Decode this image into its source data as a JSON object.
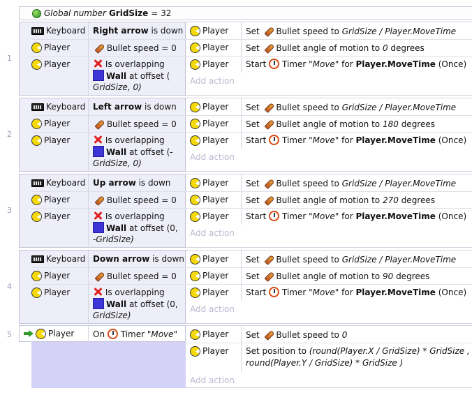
{
  "global": {
    "label": "Global number",
    "name": "GridSize",
    "value": "= 32"
  },
  "events": [
    {
      "number": "1",
      "conditions": [
        {
          "object": "Keyboard",
          "icon": "keyboard-icon",
          "bold": "Right arrow",
          "text": " is down"
        },
        {
          "object": "Player",
          "icon": "pacman-icon",
          "text": "Bullet speed = 0"
        },
        {
          "object": "Player",
          "icon": "pacman-icon",
          "line1": "Is overlapping",
          "wall": "Wall",
          "line2": " at offset (",
          "line3": "GridSize, 0)"
        }
      ],
      "actions": [
        {
          "object": "Player",
          "verb": "Set",
          "text": "Bullet speed to ",
          "expr": "GridSize / Player.MoveTime"
        },
        {
          "object": "Player",
          "verb": "Set",
          "text": "Bullet angle of motion to ",
          "expr": "0",
          "tail": " degrees"
        },
        {
          "object": "Player",
          "verb": "Start",
          "text": "Timer ",
          "expr": "\"Move\"",
          "for": " for ",
          "bold": "Player.MoveTime",
          "tail": " (Once)"
        }
      ]
    },
    {
      "number": "2",
      "conditions": [
        {
          "object": "Keyboard",
          "icon": "keyboard-icon",
          "bold": "Left arrow",
          "text": " is down"
        },
        {
          "object": "Player",
          "icon": "pacman-icon",
          "text": "Bullet speed = 0"
        },
        {
          "object": "Player",
          "icon": "pacman-icon",
          "line1": "Is overlapping",
          "wall": "Wall",
          "line2": " at offset (-",
          "line3": "GridSize, 0)"
        }
      ],
      "actions": [
        {
          "object": "Player",
          "verb": "Set",
          "text": "Bullet speed to ",
          "expr": "GridSize / Player.MoveTime"
        },
        {
          "object": "Player",
          "verb": "Set",
          "text": "Bullet angle of motion to ",
          "expr": "180",
          "tail": " degrees"
        },
        {
          "object": "Player",
          "verb": "Start",
          "text": "Timer ",
          "expr": "\"Move\"",
          "for": " for ",
          "bold": "Player.MoveTime",
          "tail": " (Once)"
        }
      ]
    },
    {
      "number": "3",
      "conditions": [
        {
          "object": "Keyboard",
          "icon": "keyboard-icon",
          "bold": "Up arrow",
          "text": " is down"
        },
        {
          "object": "Player",
          "icon": "pacman-icon",
          "text": "Bullet speed = 0"
        },
        {
          "object": "Player",
          "icon": "pacman-icon",
          "line1": "Is overlapping",
          "wall": "Wall",
          "line2": " at offset (0,",
          "line3": "-GridSize)"
        }
      ],
      "actions": [
        {
          "object": "Player",
          "verb": "Set",
          "text": "Bullet speed to ",
          "expr": "GridSize / Player.MoveTime"
        },
        {
          "object": "Player",
          "verb": "Set",
          "text": "Bullet angle of motion to ",
          "expr": "270",
          "tail": " degrees"
        },
        {
          "object": "Player",
          "verb": "Start",
          "text": "Timer ",
          "expr": "\"Move\"",
          "for": " for ",
          "bold": "Player.MoveTime",
          "tail": " (Once)"
        }
      ]
    },
    {
      "number": "4",
      "conditions": [
        {
          "object": "Keyboard",
          "icon": "keyboard-icon",
          "bold": "Down arrow",
          "text": " is down"
        },
        {
          "object": "Player",
          "icon": "pacman-icon",
          "text": "Bullet speed = 0"
        },
        {
          "object": "Player",
          "icon": "pacman-icon",
          "line1": "Is overlapping",
          "wall": "Wall",
          "line2": " at offset (0,",
          "line3": "GridSize)"
        }
      ],
      "actions": [
        {
          "object": "Player",
          "verb": "Set",
          "text": "Bullet speed to ",
          "expr": "GridSize / Player.MoveTime"
        },
        {
          "object": "Player",
          "verb": "Set",
          "text": "Bullet angle of motion to ",
          "expr": "90",
          "tail": " degrees"
        },
        {
          "object": "Player",
          "verb": "Start",
          "text": "Timer ",
          "expr": "\"Move\"",
          "for": " for ",
          "bold": "Player.MoveTime",
          "tail": " (Once)"
        }
      ]
    },
    {
      "number": "5",
      "trigger": {
        "object": "Player",
        "on": "On",
        "text": "Timer ",
        "expr": "\"Move\""
      },
      "actions": [
        {
          "object": "Player",
          "verb": "Set",
          "text": "Bullet speed to ",
          "expr": "0"
        },
        {
          "object": "Player",
          "verb": "Set position to",
          "line1": " (round(Player.X / GridSize) * GridSize   ,",
          "line2": "round(Player.Y / GridSize) * GridSize   )"
        }
      ]
    }
  ],
  "add_action": "Add action",
  "colors": {
    "selected": "#d4d2f6",
    "condition_bg": "#eeeef8",
    "wall": "#3e35d8",
    "timer": "#d84a12"
  }
}
